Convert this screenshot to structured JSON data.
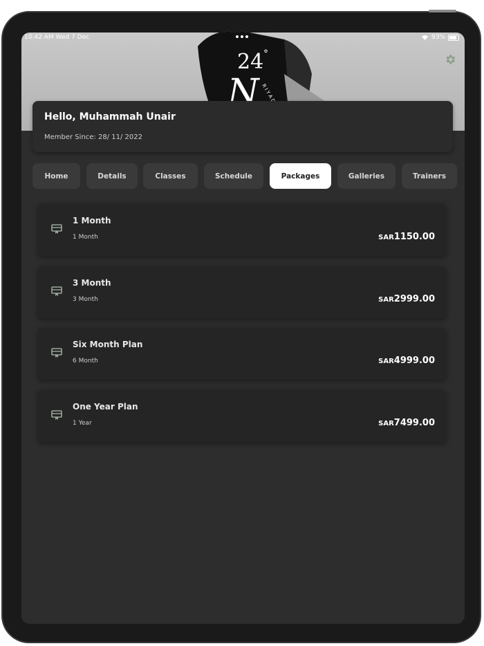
{
  "status_bar": {
    "time": "10:42 AM  Wed 7 Dec",
    "battery": "93%"
  },
  "hero": {
    "logo_text": "24° N",
    "logo_sub": "RIYADH"
  },
  "profile": {
    "greeting": "Hello, Muhammah Unair",
    "member_since": "Member Since:  28/ 11/ 2022"
  },
  "tabs": [
    {
      "label": "Home"
    },
    {
      "label": "Details"
    },
    {
      "label": "Classes"
    },
    {
      "label": "Schedule"
    },
    {
      "label": "Packages",
      "active": true
    },
    {
      "label": "Galleries"
    },
    {
      "label": "Trainers"
    }
  ],
  "packages": [
    {
      "title": "1 Month",
      "subtitle": "1 Month",
      "currency": "SAR",
      "price": "1150.00",
      "icon": "ticket-icon"
    },
    {
      "title": "3 Month",
      "subtitle": "3 Month",
      "currency": "SAR",
      "price": "2999.00",
      "icon": "ticket-icon"
    },
    {
      "title": "Six Month Plan",
      "subtitle": "6 Month",
      "currency": "SAR",
      "price": "4999.00",
      "icon": "ticket-icon"
    },
    {
      "title": "One Year Plan",
      "subtitle": "1 Year",
      "currency": "SAR",
      "price": "7499.00",
      "icon": "ticket-icon"
    }
  ],
  "colors": {
    "accent": "#9aa89a",
    "card": "#252525",
    "background": "#2d2d2d",
    "active_tab": "#ffffff"
  }
}
